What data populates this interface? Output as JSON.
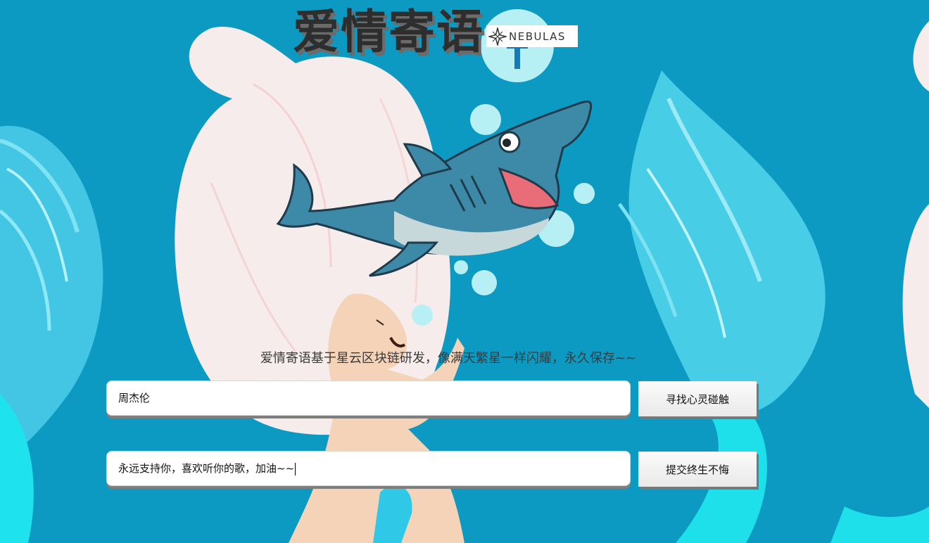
{
  "header": {
    "title": "爱情寄语",
    "logo_text": "NEBULAS"
  },
  "subtitle": "爱情寄语基于星云区块链研发，像满天繁星一样闪耀，永久保存~~",
  "search": {
    "value": "周杰伦",
    "button_label": "寻找心灵碰触"
  },
  "message": {
    "value": "永远支持你，喜欢听你的歌，加油~~",
    "button_label": "提交终生不悔"
  },
  "colors": {
    "background": "#0c9ac3",
    "title_text": "#2e2e2e",
    "mermaid_hair": "#f5ecec",
    "mermaid_tail": "#2fd6ea"
  },
  "icons": {
    "logo": "nebulas-star-icon",
    "illustration": "mermaid-and-shark-illustration"
  }
}
